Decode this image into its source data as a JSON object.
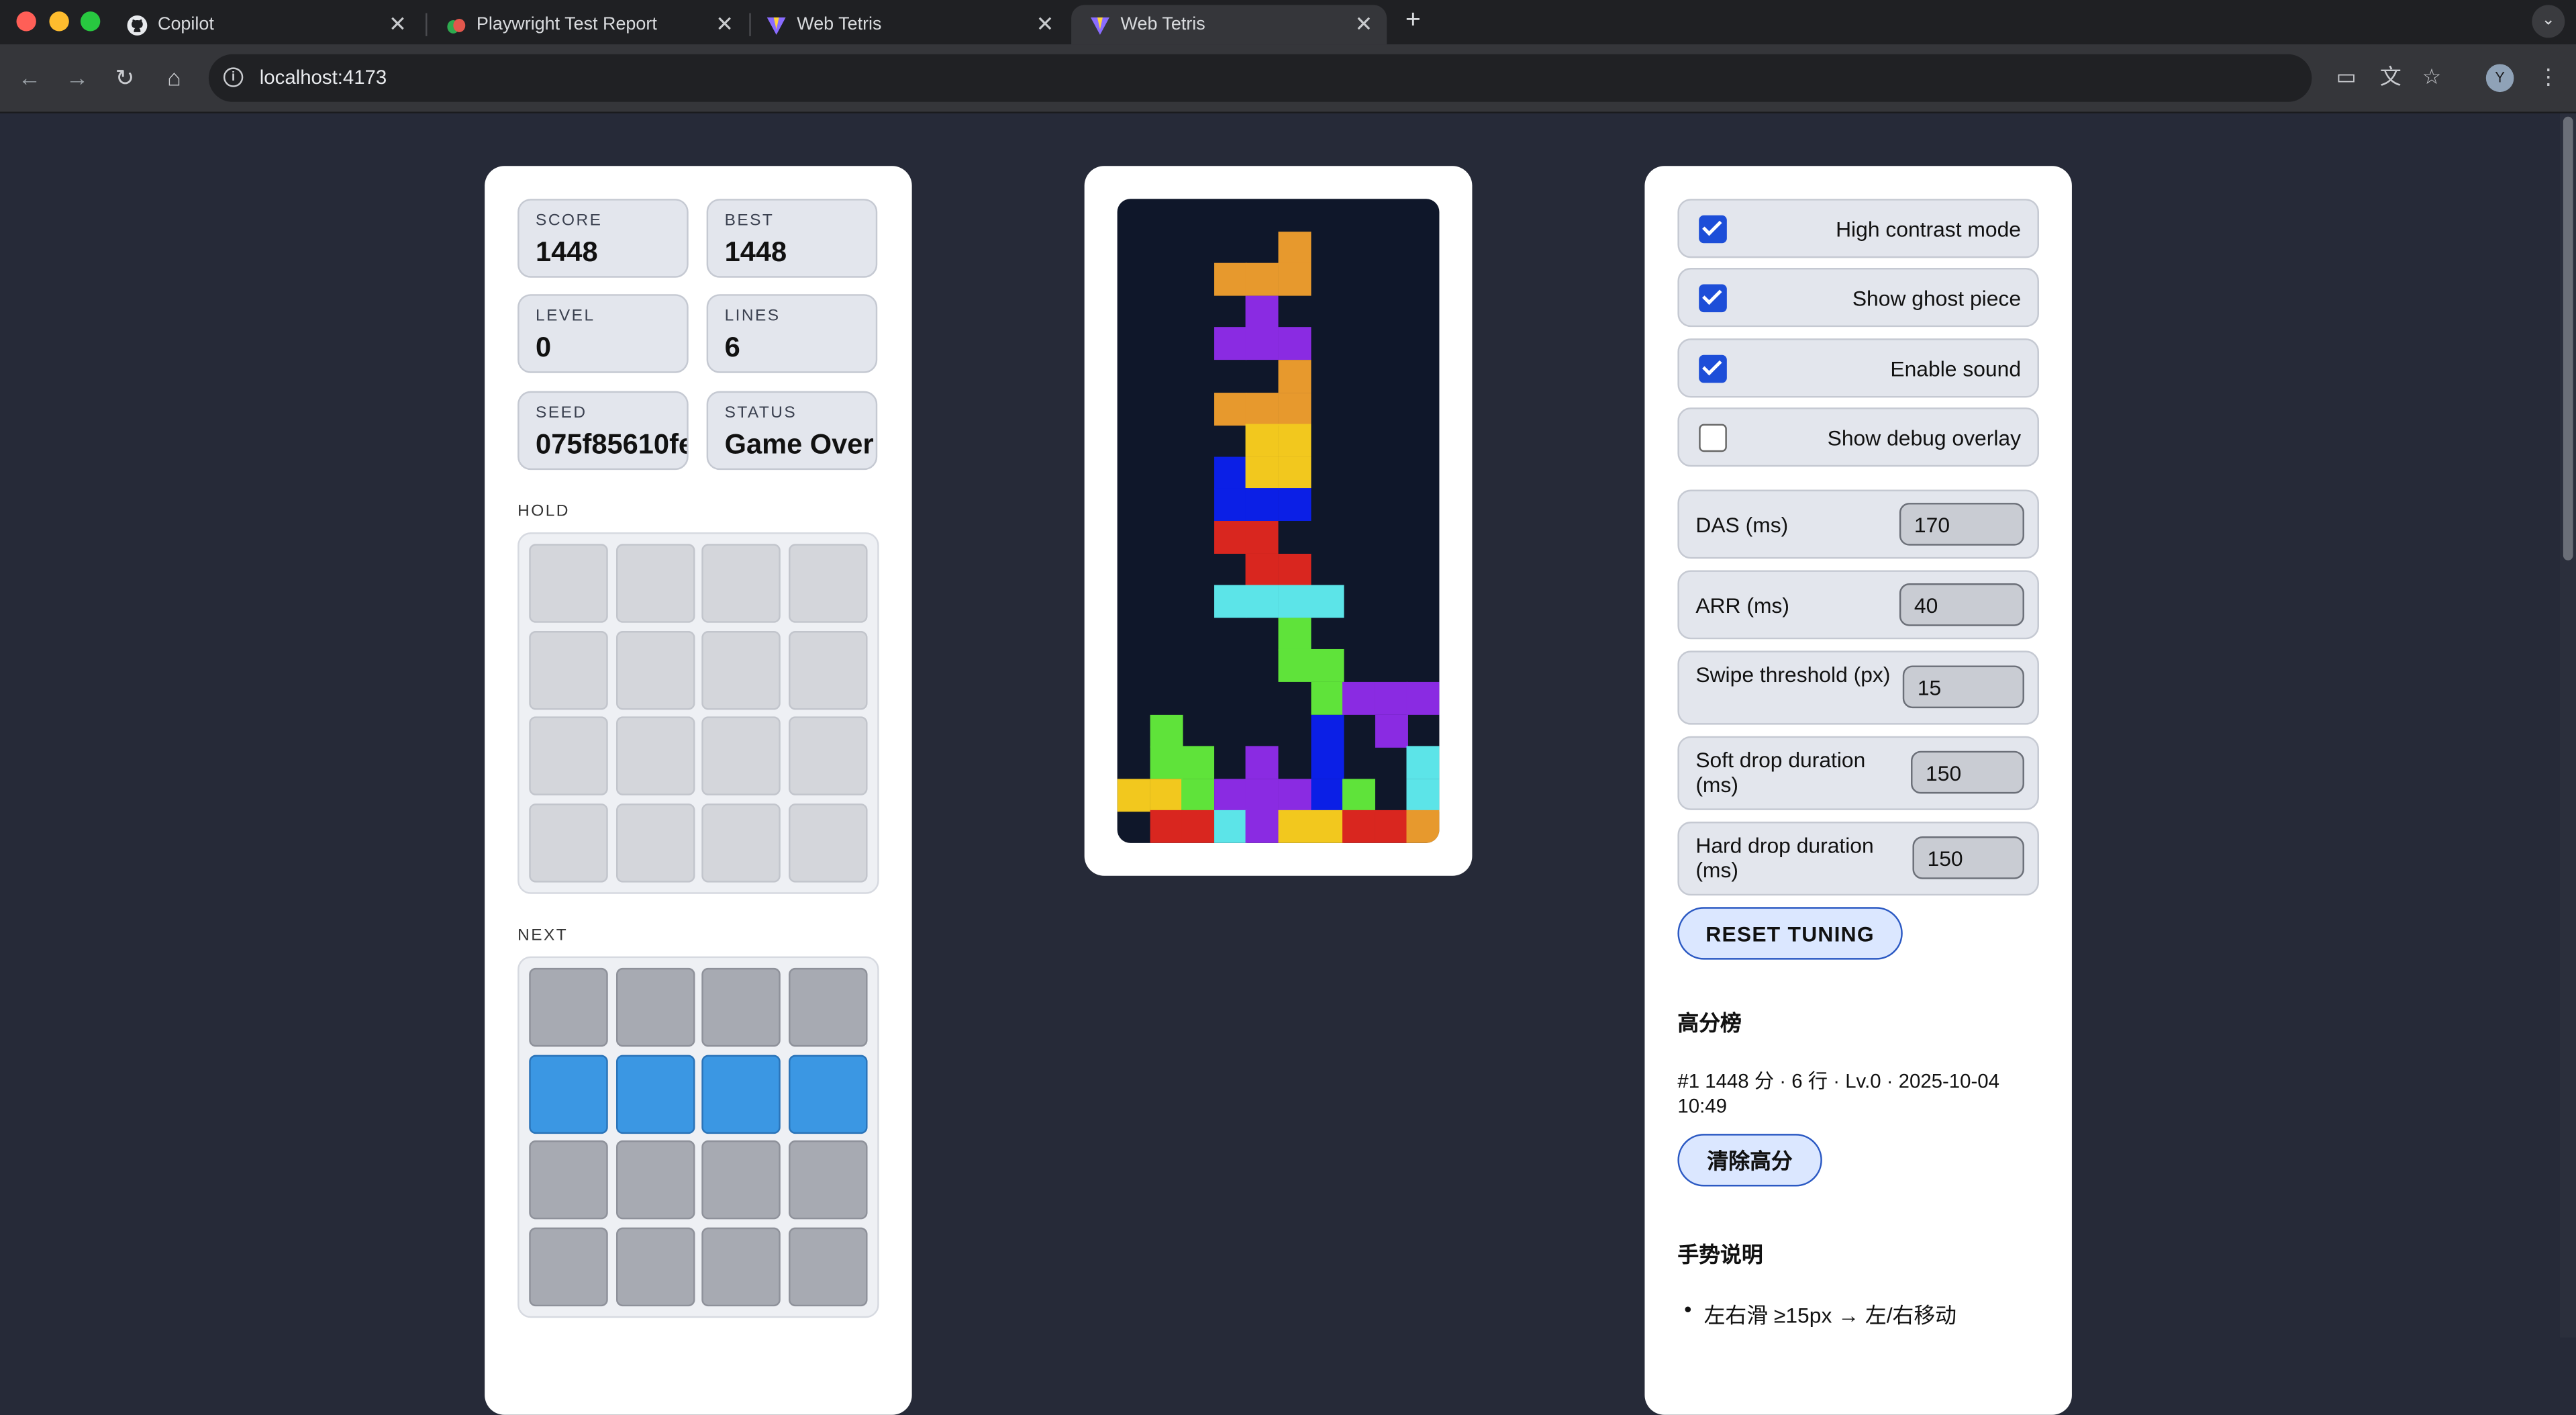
{
  "browser": {
    "tabs": [
      {
        "title": "Copilot",
        "icon": "github-icon",
        "active": false
      },
      {
        "title": "Playwright Test Report",
        "icon": "playwright-icon",
        "active": false
      },
      {
        "title": "Web Tetris",
        "icon": "vite-icon",
        "active": false
      },
      {
        "title": "Web Tetris",
        "icon": "vite-icon",
        "active": true
      }
    ],
    "url": "localhost:4173",
    "profile_initial": "Y"
  },
  "stats": {
    "score": {
      "label": "SCORE",
      "value": "1448"
    },
    "best": {
      "label": "BEST",
      "value": "1448"
    },
    "level": {
      "label": "LEVEL",
      "value": "0"
    },
    "lines": {
      "label": "LINES",
      "value": "6"
    },
    "seed": {
      "label": "SEED",
      "value": "075f85610fe"
    },
    "status": {
      "label": "STATUS",
      "value": "Game Over"
    }
  },
  "hold": {
    "label": "HOLD"
  },
  "next": {
    "label": "NEXT",
    "filled_row": 1,
    "piece_color": "#3b97e3"
  },
  "board": {
    "cols": 10,
    "rows": 20,
    "palette": {
      "O": "#f2c81e",
      "I": "#5ce4e8",
      "T": "#8a2be2",
      "L": "#e7992d",
      "J": "#0b1fe6",
      "S": "#5fe33a",
      "Z": "#d9261f"
    },
    "cells": [
      [
        1,
        5,
        "L"
      ],
      [
        2,
        5,
        "L"
      ],
      [
        2,
        3,
        "L"
      ],
      [
        2,
        4,
        "L"
      ],
      [
        3,
        4,
        "T"
      ],
      [
        4,
        3,
        "T"
      ],
      [
        4,
        4,
        "T"
      ],
      [
        4,
        5,
        "T"
      ],
      [
        5,
        5,
        "L"
      ],
      [
        6,
        3,
        "L"
      ],
      [
        6,
        4,
        "L"
      ],
      [
        6,
        5,
        "L"
      ],
      [
        7,
        4,
        "O"
      ],
      [
        7,
        5,
        "O"
      ],
      [
        8,
        3,
        "J"
      ],
      [
        8,
        4,
        "O"
      ],
      [
        8,
        5,
        "O"
      ],
      [
        9,
        3,
        "J"
      ],
      [
        9,
        4,
        "J"
      ],
      [
        9,
        5,
        "J"
      ],
      [
        10,
        3,
        "Z"
      ],
      [
        10,
        4,
        "Z"
      ],
      [
        11,
        4,
        "Z"
      ],
      [
        11,
        5,
        "Z"
      ],
      [
        12,
        3,
        "I"
      ],
      [
        12,
        4,
        "I"
      ],
      [
        12,
        5,
        "I"
      ],
      [
        12,
        6,
        "I"
      ],
      [
        13,
        5,
        "S"
      ],
      [
        14,
        5,
        "S"
      ],
      [
        14,
        6,
        "S"
      ],
      [
        15,
        6,
        "S"
      ],
      [
        15,
        7,
        "T"
      ],
      [
        15,
        8,
        "T"
      ],
      [
        15,
        9,
        "T"
      ],
      [
        16,
        1,
        "S"
      ],
      [
        16,
        8,
        "T"
      ],
      [
        16,
        6,
        "J"
      ],
      [
        17,
        1,
        "S"
      ],
      [
        17,
        2,
        "S"
      ],
      [
        17,
        4,
        "T"
      ],
      [
        17,
        6,
        "J"
      ],
      [
        17,
        9,
        "I"
      ],
      [
        18,
        0,
        "O"
      ],
      [
        18,
        1,
        "O"
      ],
      [
        18,
        2,
        "S"
      ],
      [
        18,
        3,
        "T"
      ],
      [
        18,
        4,
        "T"
      ],
      [
        18,
        5,
        "T"
      ],
      [
        18,
        6,
        "J"
      ],
      [
        18,
        7,
        "S"
      ],
      [
        18,
        9,
        "I"
      ],
      [
        19,
        1,
        "Z"
      ],
      [
        19,
        2,
        "Z"
      ],
      [
        19,
        3,
        "I"
      ],
      [
        19,
        4,
        "T"
      ],
      [
        19,
        5,
        "O"
      ],
      [
        19,
        6,
        "O"
      ],
      [
        19,
        7,
        "Z"
      ],
      [
        19,
        8,
        "Z"
      ],
      [
        19,
        9,
        "L"
      ]
    ]
  },
  "settings": {
    "toggles": [
      {
        "label": "High contrast mode",
        "checked": true
      },
      {
        "label": "Show ghost piece",
        "checked": true
      },
      {
        "label": "Enable sound",
        "checked": true
      },
      {
        "label": "Show debug overlay",
        "checked": false
      }
    ],
    "tuning": [
      {
        "label": "DAS (ms)",
        "value": "170"
      },
      {
        "label": "ARR (ms)",
        "value": "40"
      },
      {
        "label": "Swipe threshold (px)",
        "value": "15"
      },
      {
        "label": "Soft drop duration (ms)",
        "value": "150"
      },
      {
        "label": "Hard drop duration (ms)",
        "value": "150"
      }
    ],
    "reset_label": "RESET TUNING"
  },
  "leaderboard": {
    "title": "高分榜",
    "entries": [
      "#1 1448 分 · 6 行 · Lv.0 · 2025-10-04 10:49"
    ],
    "clear_label": "清除高分"
  },
  "gestures": {
    "title": "手势说明",
    "items": [
      "左右滑 ≥15px → 左/右移动"
    ]
  },
  "colors": {
    "accent": "#1d4ed8",
    "page_bg": "#262a38",
    "board_bg": "#0f172a"
  }
}
